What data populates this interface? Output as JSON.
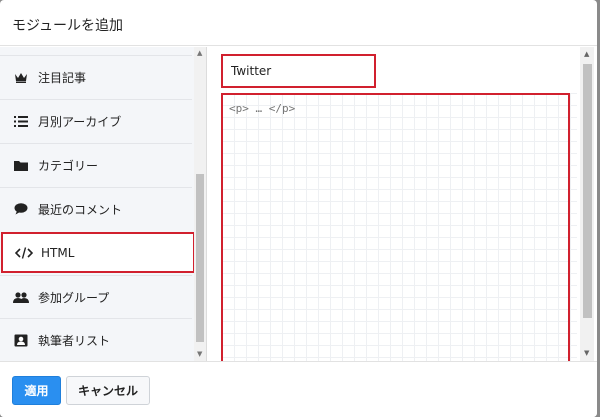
{
  "dialog": {
    "title": "モジュールを追加"
  },
  "sidebar": {
    "items": [
      {
        "label": "注目記事",
        "icon": "crown-icon"
      },
      {
        "label": "月別アーカイブ",
        "icon": "list-icon"
      },
      {
        "label": "カテゴリー",
        "icon": "folder-icon"
      },
      {
        "label": "最近のコメント",
        "icon": "comment-icon"
      },
      {
        "label": "HTML",
        "icon": "code-icon"
      },
      {
        "label": "参加グループ",
        "icon": "users-icon"
      },
      {
        "label": "執筆者リスト",
        "icon": "contact-card-icon"
      }
    ]
  },
  "editor": {
    "title_value": "Twitter",
    "code_placeholder": "<p> … </p>"
  },
  "footer": {
    "apply_label": "適用",
    "cancel_label": "キャンセル"
  },
  "colors": {
    "highlight": "#d1202e",
    "primary": "#2a8ff0"
  }
}
